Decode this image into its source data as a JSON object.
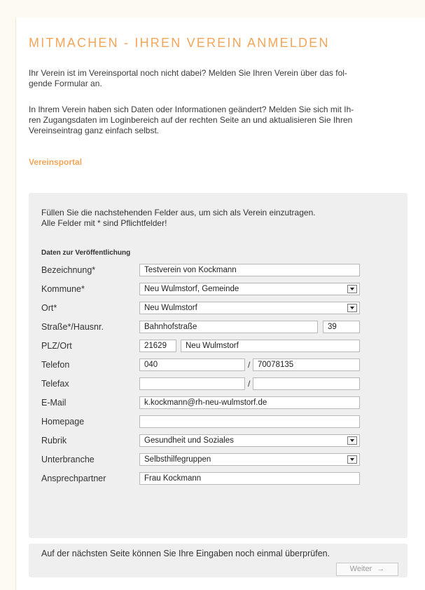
{
  "title": "MITMACHEN - IHREN VEREIN ANMELDEN",
  "paragraph1_line1": "Ihr Verein ist im Vereinsportal noch nicht dabei? Melden Sie Ihren Verein über das fol-",
  "paragraph1_line2": "gende Formular an.",
  "paragraph2_line1": "In Ihrem Verein haben sich Daten oder Informationen geändert? Melden Sie sich mit Ih-",
  "paragraph2_line2": "ren Zugangsdaten im Loginbereich auf der rechten Seite an und aktualisieren Sie Ihren",
  "paragraph2_line3": "Vereinseintrag ganz einfach selbst.",
  "portal_link": "Vereinsportal",
  "form": {
    "intro_line1": "Füllen Sie die nachstehenden Felder aus, um sich als Verein einzutragen.",
    "intro_line2": "Alle Felder mit * sind Pflichtfelder!",
    "section_title": "Daten zur Veröffentlichung",
    "bezeichnung": {
      "label": "Bezeichnung*",
      "value": "Testverein von Kockmann"
    },
    "kommune": {
      "label": "Kommune*",
      "value": "Neu Wulmstorf, Gemeinde"
    },
    "ort": {
      "label": "Ort*",
      "value": "Neu Wulmstorf"
    },
    "strasse": {
      "label": "Straße*/Hausnr.",
      "value": "Bahnhofstraße",
      "hausnr": "39"
    },
    "plz_ort": {
      "label": "PLZ/Ort",
      "plz": "21629",
      "ort": "Neu Wulmstorf"
    },
    "telefon": {
      "label": "Telefon",
      "vorwahl": "040",
      "nummer": "70078135"
    },
    "telefax": {
      "label": "Telefax",
      "vorwahl": "",
      "nummer": ""
    },
    "email": {
      "label": "E-Mail",
      "value": "k.kockmann@rh-neu-wulmstorf.de"
    },
    "homepage": {
      "label": "Homepage",
      "value": ""
    },
    "rubrik": {
      "label": "Rubrik",
      "value": "Gesundheit und Soziales"
    },
    "unterbranche": {
      "label": "Unterbranche",
      "value": "Selbsthilfegruppen"
    },
    "ansprechpartner": {
      "label": "Ansprechpartner",
      "value": "Frau Kockmann"
    },
    "separator": "/"
  },
  "footer": {
    "text": "Auf der nächsten Seite können Sie Ihre Eingaben noch einmal überprüfen.",
    "button_label": "Weiter",
    "button_icon": "arrow-right-icon"
  }
}
